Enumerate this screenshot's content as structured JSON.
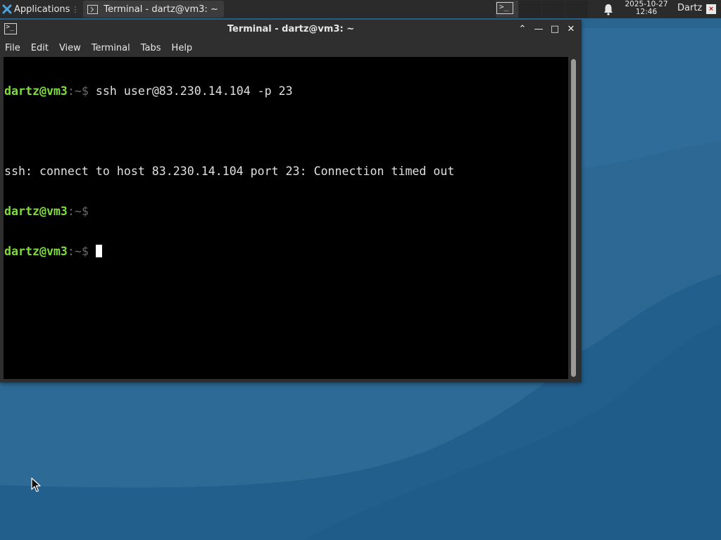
{
  "panel": {
    "applications_label": "Applications",
    "task_title": "Terminal - dartz@vm3: ~",
    "clock_date": "2025-10-27",
    "clock_time": "12:46",
    "user": "Dartz",
    "logout_symbol": "×",
    "icons": [
      "xfce-logo-icon",
      "terminal-icon",
      "bell-icon"
    ]
  },
  "window": {
    "title": "Terminal - dartz@vm3: ~",
    "controls": {
      "shade": "⌃",
      "minimize": "—",
      "maximize": "□",
      "close": "✕"
    },
    "menu": [
      "File",
      "Edit",
      "View",
      "Terminal",
      "Tabs",
      "Help"
    ]
  },
  "terminal": {
    "prompt_user": "dartz@vm3",
    "prompt_suffix": ":~$",
    "lines": [
      {
        "type": "prompt",
        "command": " ssh user@83.230.14.104 -p 23"
      },
      {
        "type": "output",
        "text": ""
      },
      {
        "type": "output",
        "text": "ssh: connect to host 83.230.14.104 port 23: Connection timed out"
      },
      {
        "type": "prompt",
        "command": ""
      },
      {
        "type": "prompt",
        "command": " "
      }
    ]
  },
  "colors": {
    "desktop_bg": "#2a6591",
    "panel_bg": "#2b2b2b",
    "window_bg": "#2f2f2f",
    "terminal_bg": "#000000",
    "prompt_user": "#7fdc3e",
    "terminal_fg": "#e0e0e0"
  }
}
